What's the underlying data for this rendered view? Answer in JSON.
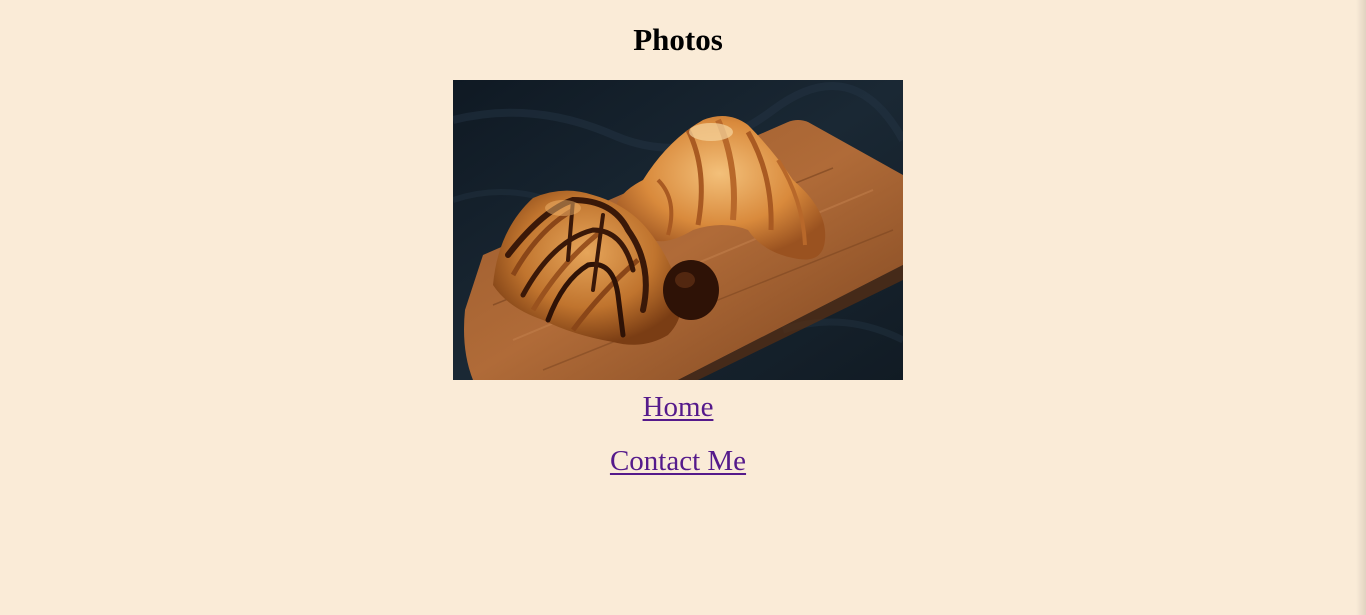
{
  "page": {
    "title": "Photos",
    "background_color": "#faebd7",
    "link_color": "#551a8b"
  },
  "photo": {
    "alt": "croissants on wooden board"
  },
  "nav": {
    "home_label": "Home",
    "contact_label": "Contact Me"
  }
}
